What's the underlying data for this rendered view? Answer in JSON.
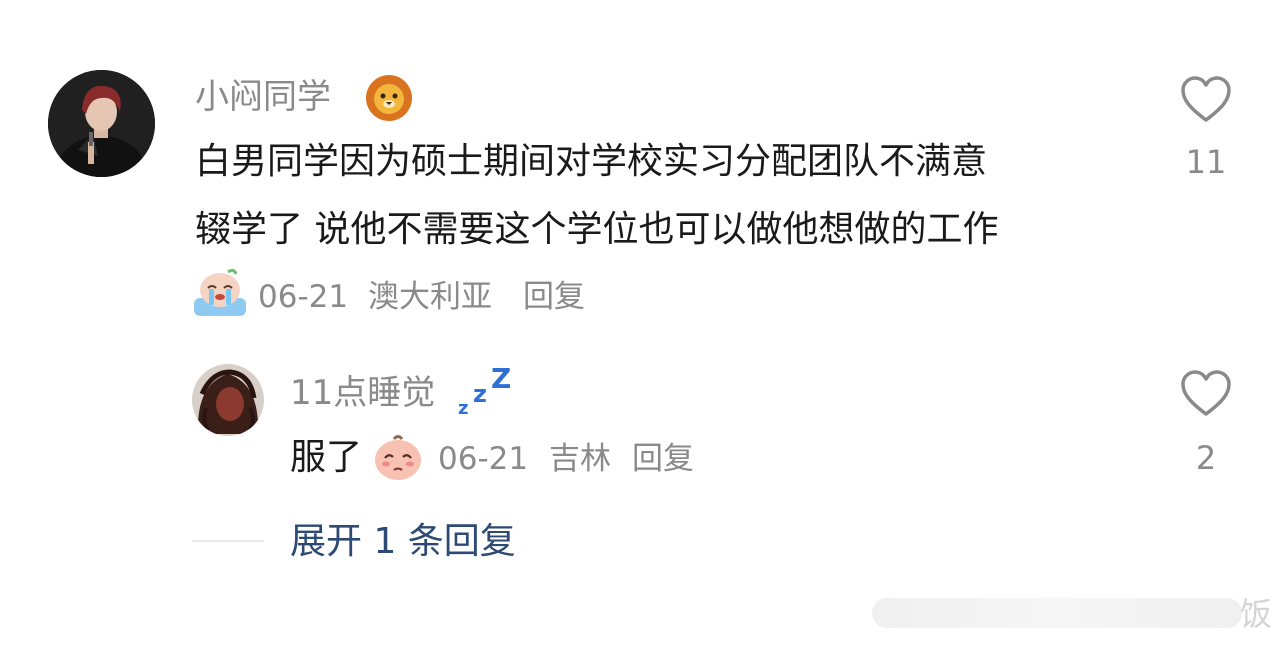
{
  "comment": {
    "username": "小闷同学",
    "username_badge": "lion-emoji",
    "text_line1": "白男同学因为硕士期间对学校实习分配团队不满意",
    "text_line2": "辍学了 说他不需要这个学位也可以做他想做的工作",
    "sticker": "crying-sticker",
    "date": "06-21",
    "location": "澳大利亚",
    "reply_label": "回复",
    "like_count": "11"
  },
  "reply": {
    "username": "11点睡觉",
    "username_badge": "zzz-emoji",
    "text": "服了",
    "sticker": "sad-peach-sticker",
    "date": "06-21",
    "location": "吉林",
    "reply_label": "回复",
    "like_count": "2"
  },
  "expand_label": "展开 1 条回复",
  "watermark": "饭",
  "colors": {
    "link": "#2c4a74",
    "muted": "#8a8a8a",
    "text": "#1a1a1a"
  }
}
